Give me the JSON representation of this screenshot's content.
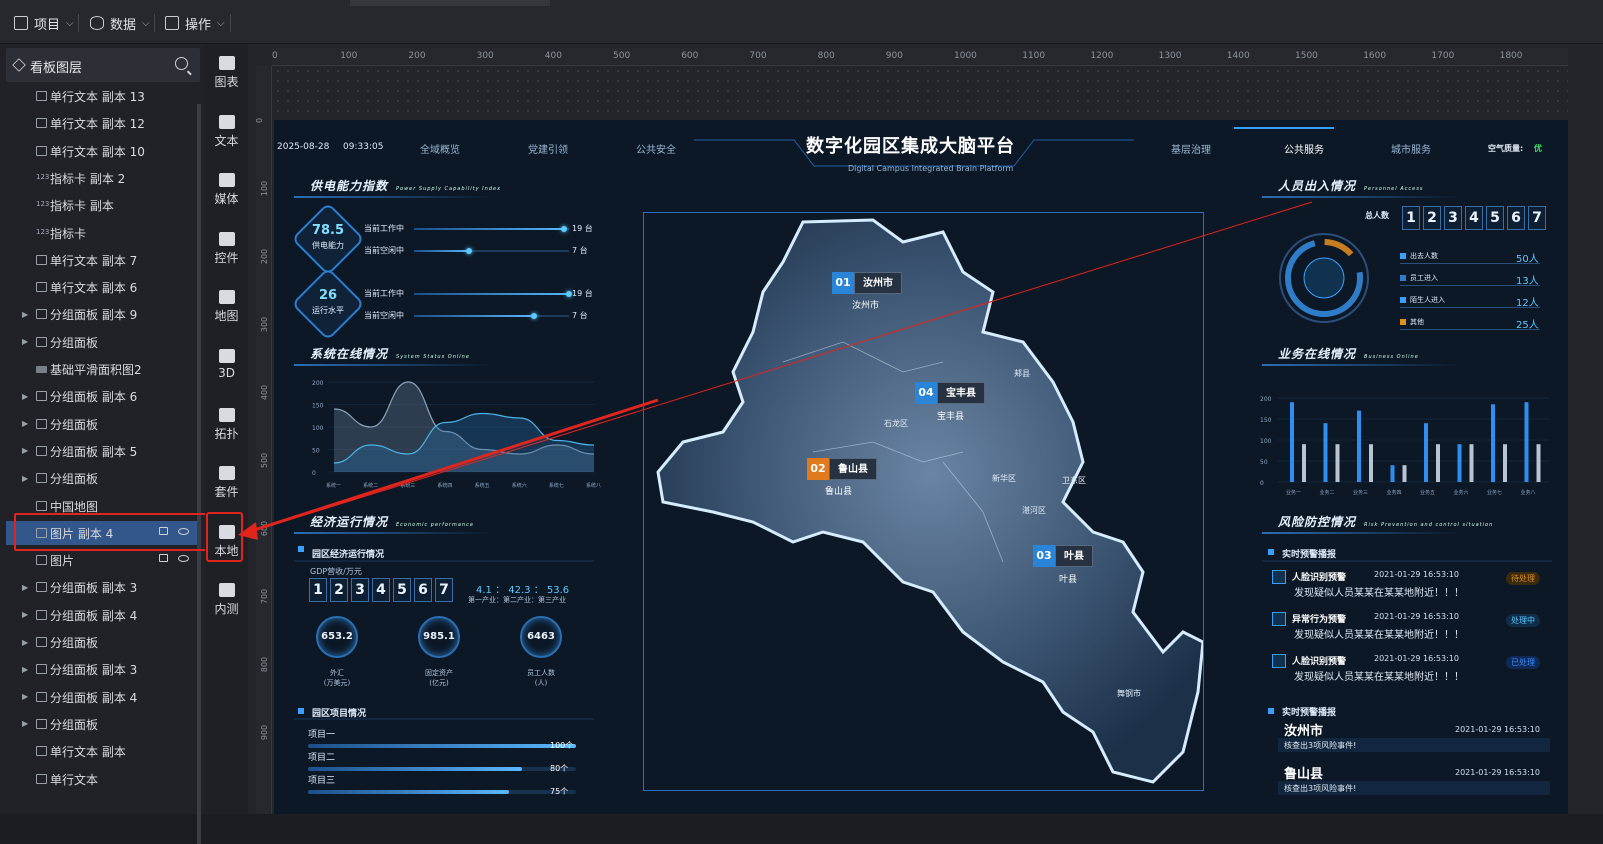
{
  "menu": {
    "project": "项目",
    "data": "数据",
    "ops": "操作"
  },
  "layers": {
    "title": "看板图层",
    "items": [
      {
        "label": "单行文本 副本 13",
        "icon": "text"
      },
      {
        "label": "单行文本 副本 12",
        "icon": "text"
      },
      {
        "label": "单行文本 副本 10",
        "icon": "text"
      },
      {
        "label": "指标卡 副本 2",
        "icon": "num"
      },
      {
        "label": "指标卡 副本",
        "icon": "num"
      },
      {
        "label": "指标卡",
        "icon": "num"
      },
      {
        "label": "单行文本 副本 7",
        "icon": "text"
      },
      {
        "label": "单行文本 副本 6",
        "icon": "text"
      },
      {
        "label": "分组面板 副本 9",
        "icon": "group",
        "arrow": true
      },
      {
        "label": "分组面板",
        "icon": "group",
        "arrow": true
      },
      {
        "label": "基础平滑面积图2",
        "icon": "folder"
      },
      {
        "label": "分组面板 副本 6",
        "icon": "group",
        "arrow": true
      },
      {
        "label": "分组面板",
        "icon": "group",
        "arrow": true
      },
      {
        "label": "分组面板 副本 5",
        "icon": "group",
        "arrow": true
      },
      {
        "label": "分组面板",
        "icon": "group",
        "arrow": true
      },
      {
        "label": "中国地图",
        "icon": "map"
      },
      {
        "label": "图片 副本 4",
        "icon": "img",
        "selected": true
      },
      {
        "label": "图片",
        "icon": "img"
      },
      {
        "label": "分组面板 副本 3",
        "icon": "group",
        "arrow": true
      },
      {
        "label": "分组面板 副本 4",
        "icon": "group",
        "arrow": true
      },
      {
        "label": "分组面板",
        "icon": "group",
        "arrow": true
      },
      {
        "label": "分组面板 副本 3",
        "icon": "group",
        "arrow": true
      },
      {
        "label": "分组面板 副本 4",
        "icon": "group",
        "arrow": true
      },
      {
        "label": "分组面板",
        "icon": "group",
        "arrow": true
      },
      {
        "label": "单行文本 副本",
        "icon": "text"
      },
      {
        "label": "单行文本",
        "icon": "text"
      }
    ]
  },
  "components": [
    "图表",
    "文本",
    "媒体",
    "控件",
    "地图",
    "3D",
    "拓扑",
    "套件",
    "本地",
    "内测"
  ],
  "ruler": {
    "top": [
      "0",
      "100",
      "200",
      "300",
      "400",
      "500",
      "600",
      "700",
      "800",
      "900",
      "1000",
      "1100",
      "1200",
      "1300",
      "1400",
      "1500",
      "1600",
      "1700",
      "1800"
    ],
    "left": [
      "0",
      "100",
      "200",
      "300",
      "400",
      "500",
      "600",
      "700",
      "800",
      "900"
    ]
  },
  "dash": {
    "date": "2025-08-28",
    "time": "09:33:05",
    "nav_left": [
      "全域概览",
      "党建引领",
      "公共安全"
    ],
    "nav_right": [
      "基层治理",
      "公共服务",
      "城市服务"
    ],
    "title": "数字化园区集成大脑平台",
    "subtitle": "Digital Campus Integrated Brain Platform",
    "air_label": "空气质量:",
    "air_value": "优",
    "supply": {
      "title": "供电能力指数",
      "en": "Power Supply Capability Index",
      "badge1": {
        "value": "78.5",
        "label": "供电能力"
      },
      "badge2": {
        "value": "26",
        "label": "运行水平"
      },
      "rows": [
        {
          "label": "当前工作中",
          "value": "19 台"
        },
        {
          "label": "当前空闲中",
          "value": "7 台"
        },
        {
          "label": "当前工作中",
          "value": "19 台"
        },
        {
          "label": "当前空闲中",
          "value": "7 台"
        }
      ]
    },
    "online": {
      "title": "系统在线情况",
      "en": "System Status Online"
    },
    "econ": {
      "title": "经济运行情况",
      "en": "Economic performance",
      "sub": "园区经济运行情况",
      "gdp_label": "GDP营收/万元",
      "digits": [
        "1",
        "2",
        "3",
        "4",
        "5",
        "6",
        "7"
      ],
      "ratio": "4.1 ： 42.3 ： 53.6",
      "ratio_label": "第一产业：第二产业：第三产业",
      "circles": [
        {
          "v": "653.2",
          "l1": "外汇",
          "l2": "(万美元)"
        },
        {
          "v": "985.1",
          "l1": "固定资产",
          "l2": "(亿元)"
        },
        {
          "v": "6463",
          "l1": "员工人数",
          "l2": "(人)"
        }
      ],
      "proj_title": "园区项目情况",
      "projects": [
        {
          "name": "项目一",
          "value": "100个",
          "pct": 1.0
        },
        {
          "name": "项目二",
          "value": "80个",
          "pct": 0.8
        },
        {
          "name": "项目三",
          "value": "75个",
          "pct": 0.75
        }
      ]
    },
    "map": {
      "markers": [
        {
          "num": "01",
          "name": "汝州市",
          "sub": "汝州市"
        },
        {
          "num": "04",
          "name": "宝丰县",
          "sub": "宝丰县"
        },
        {
          "num": "02",
          "name": "鲁山县",
          "sub": "鲁山县"
        },
        {
          "num": "03",
          "name": "叶县",
          "sub": "叶县"
        }
      ],
      "places": [
        "郏县",
        "石龙区",
        "新华区",
        "卫东区",
        "湛河区",
        "舞钢市"
      ]
    },
    "people": {
      "title": "人员出入情况",
      "en": "Personnel Access",
      "total_label": "总人数",
      "digits": [
        "1",
        "2",
        "3",
        "4",
        "5",
        "6",
        "7"
      ],
      "rows": [
        {
          "label": "出去人数",
          "value": "50人"
        },
        {
          "label": "员工进入",
          "value": "13人"
        },
        {
          "label": "陌生人进入",
          "value": "12人"
        },
        {
          "label": "其他",
          "value": "25人"
        }
      ]
    },
    "business": {
      "title": "业务在线情况",
      "en": "Business Online"
    },
    "risk": {
      "title": "风险防控情况",
      "en": "Risk Prevention and control situation",
      "sub1": "实时预警播报",
      "sub2": "实时预警播报",
      "alerts": [
        {
          "type": "人脸识别预警",
          "time": "2021-01-29   16:53:10",
          "text": "发现疑似人员某某在某某地附近！！！",
          "tag": "待处理"
        },
        {
          "type": "异常行为预警",
          "time": "2021-01-29   16:53:10",
          "text": "发现疑似人员某某在某某地附近！！！",
          "tag": "处理中"
        },
        {
          "type": "人脸识别预警",
          "time": "2021-01-29   16:53:10",
          "text": "发现疑似人员某某在某某地附近！！！",
          "tag": "已处理"
        }
      ],
      "events": [
        {
          "city": "汝州市",
          "time": "2021-01-29   16:53:10",
          "text": "核查出3项风险事件!"
        },
        {
          "city": "鲁山县",
          "time": "2021-01-29   16:53:10",
          "text": "核查出3项风险事件!"
        }
      ]
    }
  },
  "chart_data": [
    {
      "type": "area",
      "categories": [
        "系统一",
        "系统二",
        "系统三",
        "系统四",
        "系统五",
        "系统六",
        "系统七",
        "系统八"
      ],
      "ylim": [
        0,
        200
      ],
      "yticks": [
        0,
        50,
        100,
        150,
        200
      ],
      "series": [
        {
          "values": [
            140,
            100,
            200,
            90,
            50,
            40,
            60,
            40
          ]
        },
        {
          "values": [
            20,
            60,
            40,
            110,
            130,
            120,
            70,
            60
          ]
        }
      ]
    },
    {
      "type": "bar",
      "categories": [
        "业务一",
        "业务二",
        "业务三",
        "业务四",
        "业务五",
        "业务六",
        "业务七",
        "业务八"
      ],
      "ylim": [
        0,
        200
      ],
      "yticks": [
        0,
        50,
        100,
        150,
        200
      ],
      "series": [
        {
          "values": [
            190,
            140,
            170,
            40,
            140,
            90,
            185,
            190
          ]
        },
        {
          "values": [
            90,
            90,
            90,
            40,
            90,
            90,
            90,
            90
          ]
        }
      ]
    }
  ],
  "colors": {
    "accent": "#2b6fb3",
    "danger": "#e0251f",
    "bg": "#0c1826",
    "selected": "#33578a"
  }
}
